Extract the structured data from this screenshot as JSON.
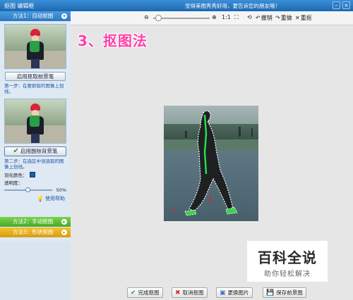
{
  "titlebar": {
    "app_title": "抠图 编辑框",
    "promo": "觉得美图秀秀好用，要告诉您的朋友哦！"
  },
  "sidebar": {
    "method1": {
      "label": "方法1：自动抠图"
    },
    "step1_button": "启用抠取前景笔",
    "step1_text": "第一步：在要抠取的图像上划线。",
    "step2_button": "启用删除背景笔",
    "step2_text": "第二步：在选区中误选取的图像上划线。",
    "edge_color_label": "羽化颜色：",
    "opacity_label": "透明度：",
    "opacity_value": "50%",
    "help_link": "使用帮助",
    "method2": {
      "label": "方法2：手动抠图"
    },
    "method3": {
      "label": "方法3：形状抠图"
    },
    "colors": {
      "edge_color": "#1c5fa8"
    }
  },
  "toolbar": {
    "zoom_ratio": "1:1",
    "undo": "撤销",
    "redo": "重做",
    "reset": "重抠"
  },
  "canvas": {
    "heading": "3、抠图法"
  },
  "watermark": {
    "title": "百科全说",
    "subtitle": "助你轻松解决"
  },
  "bottom": {
    "finish": "完成抠图",
    "cancel": "取消抠图",
    "replace": "更换图片",
    "save": "保存前景图"
  }
}
